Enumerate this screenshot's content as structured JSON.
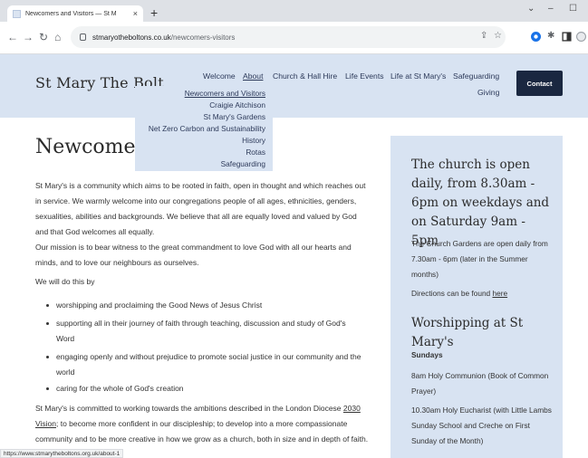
{
  "browser": {
    "tab_title": "Newcomers and Visitors — St M",
    "close_glyph": "×",
    "new_tab_glyph": "+",
    "url_host": "stmaryotheboltons.co.uk",
    "url_path": "/newcomers-visitors",
    "status_url": "https://www.stmarytheboltons.org.uk/about-1",
    "window_controls": [
      "⌄",
      "–",
      "☐"
    ]
  },
  "header": {
    "site_name": "St Mary The Bolt",
    "nav": [
      "Welcome",
      "About",
      "Church & Hall Hire",
      "Life Events",
      "Life at St Mary's",
      "Safeguarding",
      "Giving"
    ],
    "contact_label": "Contact"
  },
  "dropdown": {
    "items": [
      "Newcomers and Visitors",
      "Craigie Aitchison",
      "St Mary's Gardens",
      "Net Zero Carbon and Sustainability",
      "History",
      "Rotas",
      "Safeguarding"
    ]
  },
  "main": {
    "title": "Newcomers",
    "p1": "St Mary's is a community which aims to be rooted in faith, open in thought and which reaches out in service. We warmly welcome into our congregations people of all ages, ethnicities, genders, sexualities, abilities and backgrounds. We believe that all are equally loved and valued by God and that God welcomes all equally.",
    "p2": "Our mission is to bear witness to the great commandment to love God with all our hearts and minds, and to love our neighbours as ourselves.",
    "p3": "We will do this by",
    "bullets": [
      "worshipping and proclaiming the Good News of Jesus Christ",
      "supporting all in their journey of faith through teaching, discussion and study of God's Word",
      "engaging openly and without prejudice to promote social justice in our community and the world",
      "caring for the whole of God's creation"
    ],
    "p4_start": "St Mary's is committed to working towards the ambitions described in the London Diocese ",
    "p4_link": "2030 Vision",
    "p4_end": "; to become more confident in our discipleship; to develop into a more compassionate community and to be more creative in how we grow as a church, both in size and in depth of faith."
  },
  "sidebar": {
    "heading_open": "The church is open daily, from 8.30am - 6pm on weekdays and on Saturday 9am - 5pm",
    "gardens": "The Church Gardens are open daily from 7.30am - 6pm (later in the Summer months)",
    "directions_text": "Directions can be found ",
    "directions_link": "here",
    "heading_worship": "Worshipping at St Mary's",
    "sundays_label": "Sundays",
    "service1": "8am Holy Communion (Book of Common Prayer)",
    "service2": "10.30am Holy Eucharist (with Little Lambs Sunday School and Creche on First Sunday of the Month)"
  }
}
